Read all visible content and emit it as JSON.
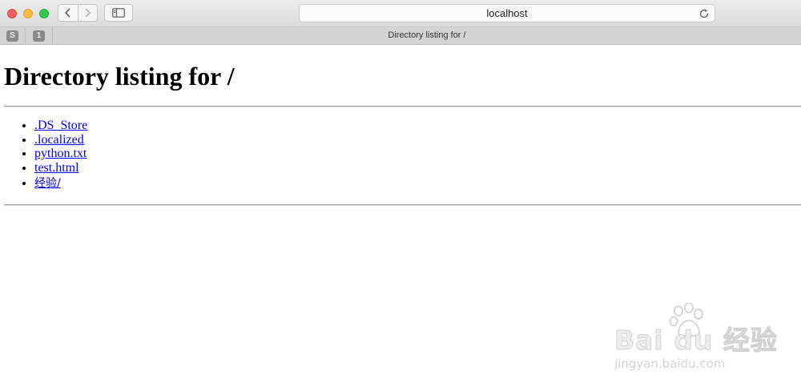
{
  "browser": {
    "address_text": "localhost",
    "tab_title": "Directory listing for /",
    "pinned_tabs": [
      {
        "label": "S"
      },
      {
        "label": "1"
      }
    ],
    "icons": [
      "back-icon",
      "forward-icon",
      "sidebar-icon",
      "reload-icon"
    ]
  },
  "page": {
    "heading": "Directory listing for /",
    "entries": [
      {
        "label": ".DS_Store"
      },
      {
        "label": ".localized"
      },
      {
        "label": "python.txt"
      },
      {
        "label": "test.html"
      },
      {
        "label": "经验/"
      }
    ]
  },
  "watermark": {
    "brand": "Bai du 经验",
    "url": "jingyan.baidu.com"
  },
  "colors": {
    "link": "#0000ee",
    "close": "#fc605c",
    "minimize": "#fdbc40",
    "zoom": "#34c84a"
  }
}
